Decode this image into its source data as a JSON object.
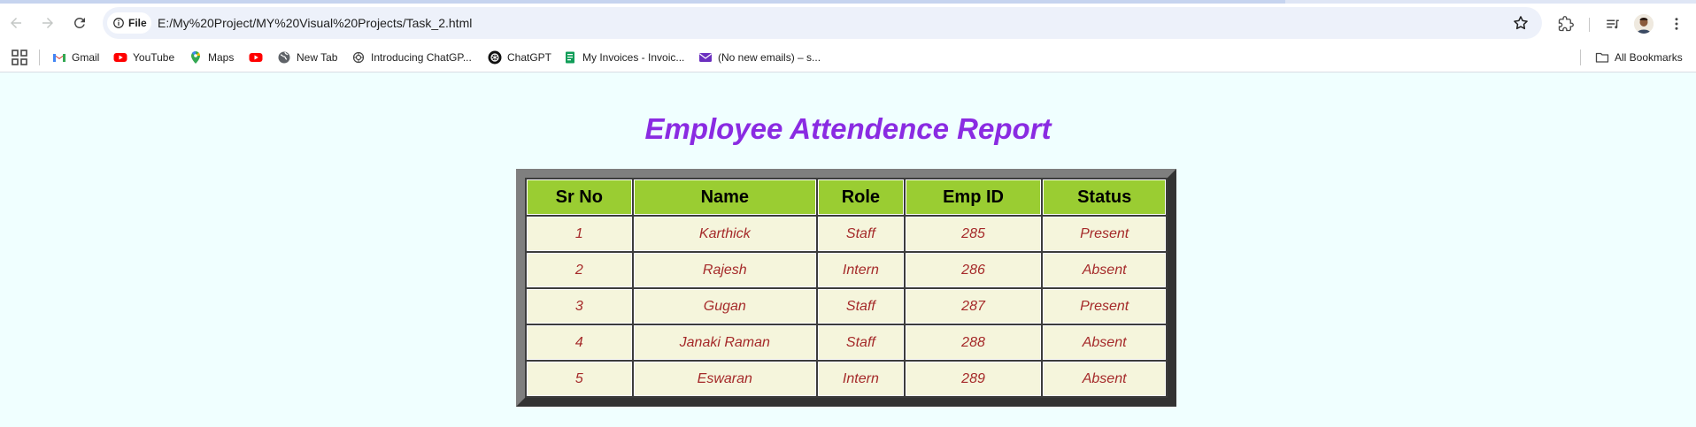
{
  "browser": {
    "url": "E:/My%20Project/MY%20Visual%20Projects/Task_2.html",
    "site_chip": "File",
    "icons": {
      "back": "back-arrow-icon",
      "forward": "forward-arrow-icon",
      "reload": "reload-icon",
      "info": "info-icon",
      "bookmark_star": "star-icon",
      "extensions": "puzzle-icon",
      "media": "media-control-icon",
      "profile": "avatar",
      "menu": "kebab-menu-icon"
    }
  },
  "bookmarks": {
    "items": [
      {
        "label": "Gmail",
        "icon": "gmail-icon"
      },
      {
        "label": "YouTube",
        "icon": "youtube-icon"
      },
      {
        "label": "Maps",
        "icon": "maps-icon"
      },
      {
        "label": "",
        "icon": "youtube-icon"
      },
      {
        "label": "New Tab",
        "icon": "globe-icon"
      },
      {
        "label": "Introducing ChatGP...",
        "icon": "openai-icon"
      },
      {
        "label": "ChatGPT",
        "icon": "chatgpt-icon"
      },
      {
        "label": "My Invoices - Invoic...",
        "icon": "invoice-icon"
      },
      {
        "label": "(No new emails) – s...",
        "icon": "mail-icon"
      }
    ],
    "all_bookmarks": "All Bookmarks"
  },
  "page": {
    "title": "Employee Attendence Report",
    "title_color": "#8a2be2",
    "table": {
      "headers": [
        "Sr No",
        "Name",
        "Role",
        "Emp ID",
        "Status"
      ],
      "rows": [
        [
          "1",
          "Karthick",
          "Staff",
          "285",
          "Present"
        ],
        [
          "2",
          "Rajesh",
          "Intern",
          "286",
          "Absent"
        ],
        [
          "3",
          "Gugan",
          "Staff",
          "287",
          "Present"
        ],
        [
          "4",
          "Janaki Raman",
          "Staff",
          "288",
          "Absent"
        ],
        [
          "5",
          "Eswaran",
          "Intern",
          "289",
          "Absent"
        ]
      ],
      "header_bg": "#9acd32",
      "cell_bg": "#f5f5dc",
      "cell_text": "#a52a2a"
    }
  }
}
